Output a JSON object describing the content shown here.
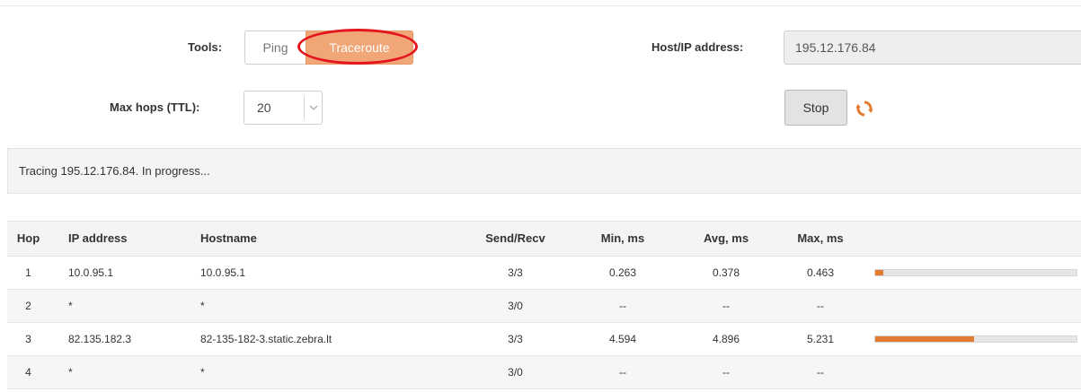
{
  "tools": {
    "label": "Tools:",
    "options": [
      "Ping",
      "Traceroute"
    ],
    "selected": "Traceroute"
  },
  "host": {
    "label": "Host/IP address:",
    "value": "195.12.176.84"
  },
  "ttl": {
    "label": "Max hops (TTL):",
    "value": "20"
  },
  "stop_label": "Stop",
  "status_text": "Tracing 195.12.176.84. In progress...",
  "colors": {
    "accent": "#e17b30",
    "selected_tab": "#f0a677",
    "highlight_ring": "#e3161e"
  },
  "table": {
    "columns": [
      "Hop",
      "IP address",
      "Hostname",
      "Send/Recv",
      "Min, ms",
      "Avg, ms",
      "Max, ms"
    ],
    "rows": [
      {
        "hop": "1",
        "ip": "10.0.95.1",
        "hostname": "10.0.95.1",
        "send_recv": "3/3",
        "min": "0.263",
        "avg": "0.378",
        "max": "0.463",
        "bar_fraction": 0.04
      },
      {
        "hop": "2",
        "ip": "*",
        "hostname": "*",
        "send_recv": "3/0",
        "min": "--",
        "avg": "--",
        "max": "--"
      },
      {
        "hop": "3",
        "ip": "82.135.182.3",
        "hostname": "82-135-182-3.static.zebra.lt",
        "send_recv": "3/3",
        "min": "4.594",
        "avg": "4.896",
        "max": "5.231",
        "bar_fraction": 0.49
      },
      {
        "hop": "4",
        "ip": "*",
        "hostname": "*",
        "send_recv": "3/0",
        "min": "--",
        "avg": "--",
        "max": "--"
      }
    ]
  }
}
